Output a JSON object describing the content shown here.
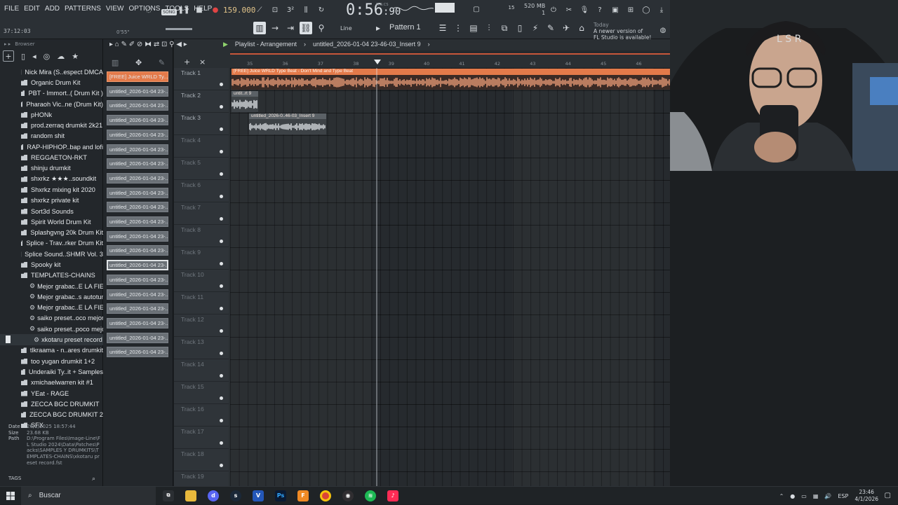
{
  "menu": [
    "FILE",
    "EDIT",
    "ADD",
    "PATTERNS",
    "VIEW",
    "OPTIONS",
    "TOOLS",
    "HELP"
  ],
  "transport": {
    "song_label": "SONG",
    "tempo": "159.000",
    "time_main": "0:56",
    "time_frac": "90",
    "time_unit": "M:S:CS",
    "pattern": "Pattern 1",
    "line_mode": "Line"
  },
  "counter": {
    "position": "37:12:03",
    "hint": "0'55\""
  },
  "meters": {
    "cpu_val": "15",
    "mem": "520 MB",
    "voices": "1"
  },
  "news": {
    "today": "Today",
    "text1": "A newer version of",
    "text2": "FL Studio is available!"
  },
  "browser": {
    "title": "Browser",
    "items": [
      {
        "label": "Nick Mira (S..espect DMCA",
        "type": "folder"
      },
      {
        "label": "Organic Drum Kit",
        "type": "folder"
      },
      {
        "label": "PBT - Immort..( Drum Kit )",
        "type": "folder"
      },
      {
        "label": "Pharaoh Vic..ne (Drum Kit)",
        "type": "folder"
      },
      {
        "label": "pHONk",
        "type": "folder"
      },
      {
        "label": "prod.zerraq drumkit 2k21",
        "type": "folder"
      },
      {
        "label": "random shit",
        "type": "folder"
      },
      {
        "label": "RAP-HIPHOP..bap and lofi",
        "type": "folder"
      },
      {
        "label": "REGGAETON-RKT",
        "type": "folder"
      },
      {
        "label": "shinju drumkit",
        "type": "folder"
      },
      {
        "label": "shxrkz ★★★..soundkit",
        "type": "folder"
      },
      {
        "label": "Shxrkz mixing kit 2020",
        "type": "folder"
      },
      {
        "label": "shxrkz private kit",
        "type": "folder"
      },
      {
        "label": "Sort3d Sounds",
        "type": "folder"
      },
      {
        "label": "Spirit World Drum Kit",
        "type": "folder"
      },
      {
        "label": "Splashgvng 20k Drum Kit",
        "type": "folder"
      },
      {
        "label": "Splice - Trav..rker Drum Kit",
        "type": "folder"
      },
      {
        "label": "Splice Sound..SHMR Vol. 3",
        "type": "folder"
      },
      {
        "label": "Spooky kit",
        "type": "folder"
      },
      {
        "label": "TEMPLATES-CHAINS",
        "type": "folder-open"
      },
      {
        "label": "Mejor grabac..E LA FIESTA",
        "type": "preset"
      },
      {
        "label": "Mejor grabac..s autotune)",
        "type": "preset"
      },
      {
        "label": "Mejor grabac..E LA FIESTA",
        "type": "preset"
      },
      {
        "label": "saiko preset..oco mejor v2",
        "type": "preset"
      },
      {
        "label": "saiko preset..poco mejor",
        "type": "preset"
      },
      {
        "label": "xkotaru preset record",
        "type": "preset-selected"
      },
      {
        "label": "tlkraama - n..ares drumkit",
        "type": "folder"
      },
      {
        "label": "too yugan drumkit 1+2",
        "type": "folder"
      },
      {
        "label": "Underaiki Ty..it + Samples",
        "type": "folder"
      },
      {
        "label": "xmichaelwarren kit #1",
        "type": "folder"
      },
      {
        "label": "YEat - RAGE",
        "type": "folder"
      },
      {
        "label": "ZECCA BGC DRUMKIT",
        "type": "folder"
      },
      {
        "label": "ZECCA BGC DRUMKIT 2",
        "type": "folder"
      },
      {
        "label": "SFX",
        "type": "folder"
      }
    ],
    "info": {
      "date_label": "Date",
      "date": "26/2/2025 18:57:44",
      "size_label": "Size",
      "size": "23.68 KB",
      "path_label": "Path",
      "path": "D:\\Program Files\\Image-Line\\FL Studio 2024\\Data\\Patches\\Packs\\SAMPLES Y DRUMKITS\\TEMPLATES-CHAINS\\xkotaru preset record.fst"
    },
    "tags_label": "TAGS"
  },
  "cliplist": [
    "[FREE] Juice WRLD Ty...",
    "untitled_2026-01-04 23-...",
    "untitled_2026-01-04 23-...",
    "untitled_2026-01-04 23-...",
    "untitled_2026-01-04 23-...",
    "untitled_2026-01-04 23-...",
    "untitled_2026-01-04 23-...",
    "untitled_2026-01-04 23-...",
    "untitled_2026-01-04 23-...",
    "untitled_2026-01-04 23-...",
    "untitled_2026-01-04 23-...",
    "untitled_2026-01-04 23-...",
    "untitled_2026-01-04 23-...",
    "untitled_2026-01-04 23-...",
    "untitled_2026-01-04 23-...",
    "untitled_2026-01-04 23-...",
    "untitled_2026-01-04 23-...",
    "untitled_2026-01-04 23-...",
    "untitled_2026-01-04 23-...",
    "untitled_2026-01-04 23-..."
  ],
  "playlist": {
    "title": "Playlist - Arrangement",
    "breadcrumb": "untitled_2026-01-04 23-46-03_Insert 9",
    "ruler": [
      "35",
      "36",
      "37",
      "38",
      "39",
      "40",
      "41",
      "42",
      "43",
      "44",
      "45",
      "46"
    ],
    "tracks": [
      "Track 1",
      "Track 2",
      "Track 3",
      "Track 4",
      "Track 5",
      "Track 6",
      "Track 7",
      "Track 8",
      "Track 9",
      "Track 10",
      "Track 11",
      "Track 12",
      "Track 13",
      "Track 14",
      "Track 15",
      "Track 16",
      "Track 17",
      "Track 18",
      "Track 19"
    ],
    "clips": {
      "main": "[FREE] Juice WRLD Type Beat - Don't Mind  and Type Beat",
      "t2": "untit..rt 9",
      "t3": "untitled_2026-0..46-03_Insert 9"
    }
  },
  "taskbar": {
    "search": "Buscar",
    "lang": "ESP",
    "time": "23:46",
    "date": "4/1/2026"
  },
  "colors": {
    "accent": "#e37a4a",
    "playlist_bg": "#262a2e",
    "toolbar": "#2b3035"
  }
}
